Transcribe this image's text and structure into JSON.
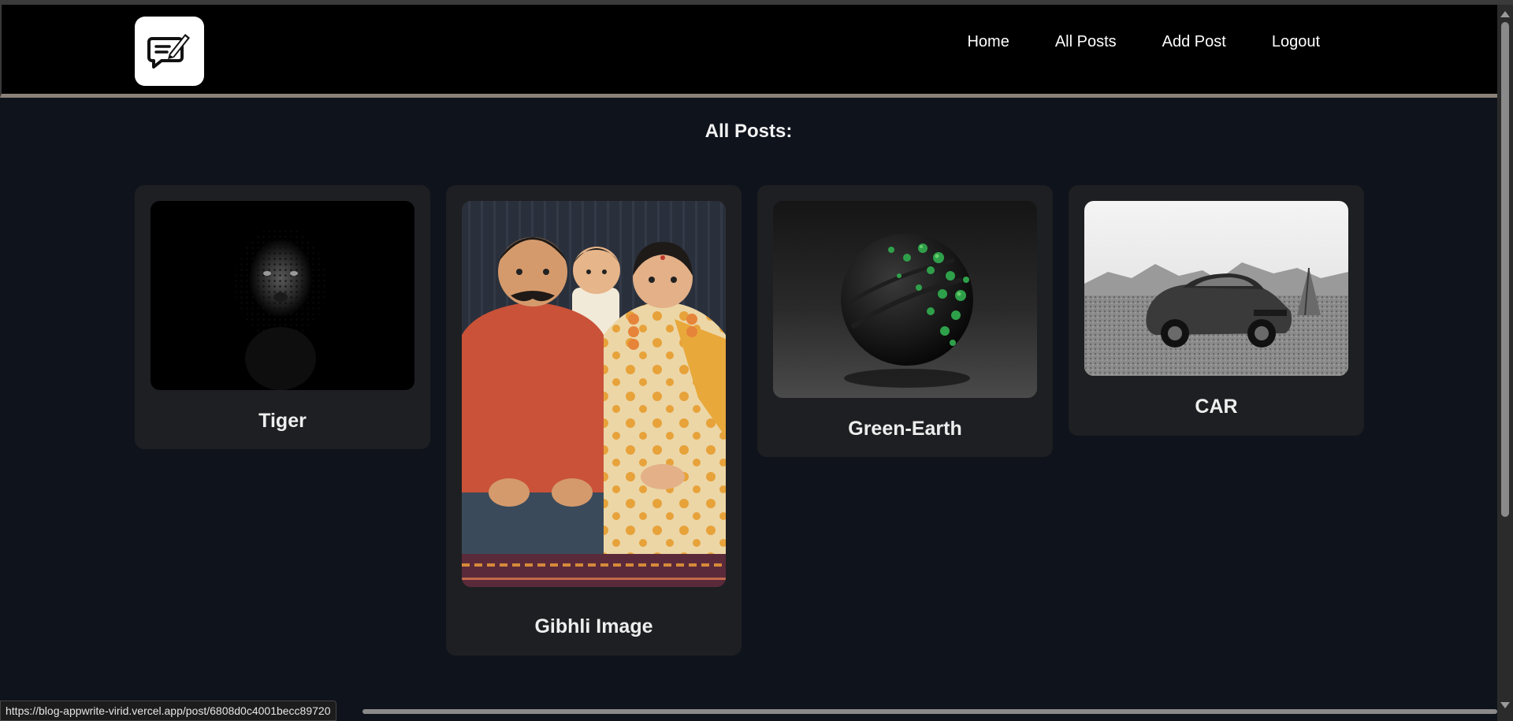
{
  "nav": {
    "items": [
      {
        "label": "Home"
      },
      {
        "label": "All Posts"
      },
      {
        "label": "Add Post"
      },
      {
        "label": "Logout"
      }
    ]
  },
  "logo": {
    "icon": "edit-message-icon"
  },
  "main": {
    "title": "All Posts:",
    "posts": [
      {
        "title": "Tiger",
        "image": "leopard-in-dark-photo"
      },
      {
        "title": "Gibhli Image",
        "image": "ghibli-style-family-portrait"
      },
      {
        "title": "Green-Earth",
        "image": "dark-sphere-green-beads-render"
      },
      {
        "title": "CAR",
        "image": "grayscale-muscle-car-desert"
      }
    ]
  },
  "status_bar": {
    "url": "https://blog-appwrite-virid.vercel.app/post/6808d0c4001becc89720"
  }
}
